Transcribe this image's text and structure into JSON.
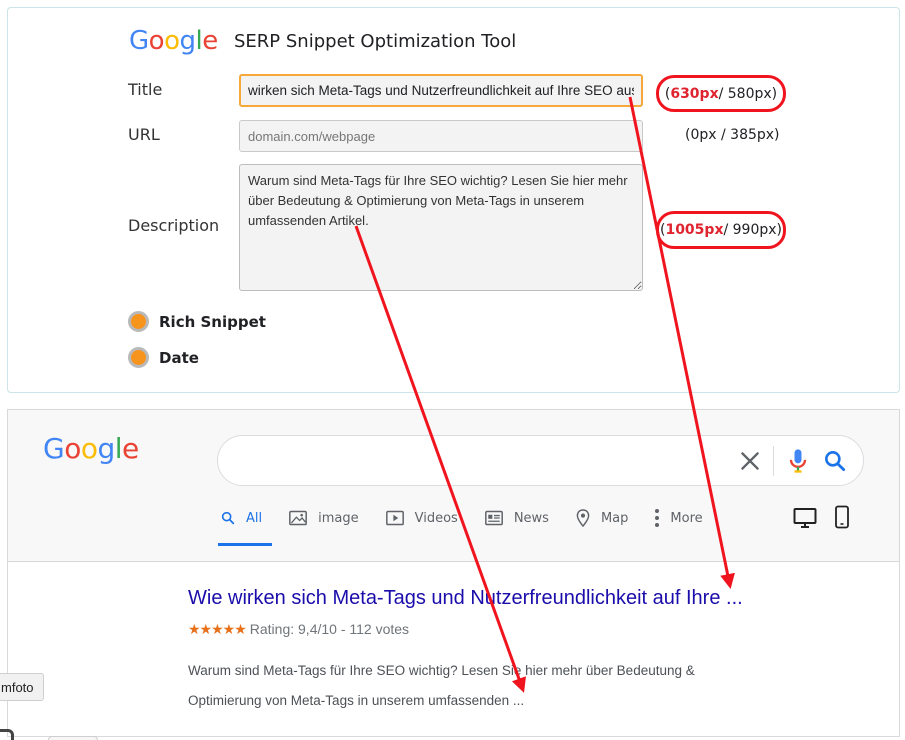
{
  "tool": {
    "logo": {
      "G": "G",
      "o1": "o",
      "o2": "o",
      "g": "g",
      "l": "l",
      "e": "e"
    },
    "title": "SERP Snippet Optimization Tool",
    "labels": {
      "title": "Title",
      "url": "URL",
      "description": "Description"
    },
    "title_value": "wirken sich Meta-Tags und Nutzerfreundlichkeit auf Ihre SEO aus",
    "url_placeholder": "domain.com/webpage",
    "description_value": "Warum sind Meta-Tags für Ihre SEO wichtig? Lesen Sie hier mehr über Bedeutung & Optimierung von Meta-Tags in unserem umfassenden Artikel.",
    "counters": {
      "title": {
        "value": "630px",
        "limit": " / 580px)"
      },
      "url": {
        "text": "(0px / 385px)"
      },
      "description": {
        "value": "1005px",
        "limit": " / 990px)"
      },
      "open_paren": "("
    },
    "toggles": {
      "rich_snippet": "Rich Snippet",
      "date": "Date"
    },
    "toggle_color": "#f7941d"
  },
  "serp": {
    "logo": {
      "G": "G",
      "o1": "o",
      "o2": "o",
      "g": "g",
      "l": "l",
      "e": "e"
    },
    "tabs": [
      {
        "label": "All",
        "icon": "search-icon"
      },
      {
        "label": "image",
        "icon": "image-icon"
      },
      {
        "label": "Videos",
        "icon": "video-icon"
      },
      {
        "label": "News",
        "icon": "news-icon"
      },
      {
        "label": "Map",
        "icon": "map-pin-icon"
      },
      {
        "label": "More",
        "icon": "more-vert-icon"
      }
    ],
    "result": {
      "title": "Wie wirken sich Meta-Tags und Nutzerfreundlichkeit auf Ihre ...",
      "stars": "★★★★★",
      "rating_text": "Rating: 9,4/10 - 112 votes",
      "description_line1": "Warum sind Meta-Tags für Ihre SEO wichtig? Lesen Sie hier mehr über Bedeutung &",
      "description_line2": "Optimierung von Meta-Tags in unserem umfassenden ..."
    },
    "colors": {
      "link": "#1a0dab",
      "accent": "#1a73e8",
      "star": "#e7711b"
    }
  },
  "overlay": {
    "tooltip_text": "mfoto",
    "highlight_color": "#f0141e"
  }
}
